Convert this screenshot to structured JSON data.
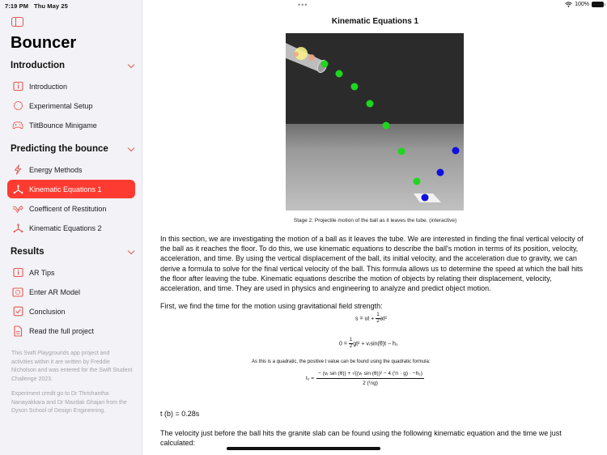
{
  "status_bar": {
    "time": "7:19 PM",
    "date": "Thu May 25",
    "battery": "100%",
    "multitask_dots": "•••"
  },
  "sidebar": {
    "app_title": "Bouncer",
    "sections": [
      {
        "title": "Introduction",
        "items": [
          {
            "label": "Introduction",
            "icon": "info-icon"
          },
          {
            "label": "Experimental Setup",
            "icon": "dashed-circle-icon"
          },
          {
            "label": "TiltBounce Minigame",
            "icon": "gamecontroller-icon"
          }
        ]
      },
      {
        "title": "Predicting the bounce",
        "items": [
          {
            "label": "Energy Methods",
            "icon": "bolt-icon"
          },
          {
            "label": "Kinematic Equations 1",
            "icon": "axes-icon",
            "active": true
          },
          {
            "label": "Coefficent of Restitution",
            "icon": "arrow-bounce-icon"
          },
          {
            "label": "Kinematic Equations 2",
            "icon": "axes-icon"
          }
        ]
      },
      {
        "title": "Results",
        "items": [
          {
            "label": "AR Tips",
            "icon": "info-icon"
          },
          {
            "label": "Enter AR Model",
            "icon": "ar-viewfinder-icon"
          },
          {
            "label": "Conclusion",
            "icon": "checkmark-square-icon"
          },
          {
            "label": "Read the full project",
            "icon": "document-icon"
          }
        ]
      }
    ],
    "footer": [
      "This Swift Playgrounds app project and activities within it are written by Freddie Nicholson and was entered for the Swift Student Challenge 2023.",
      "Experiment credit go to Dr Thrishantha Nanayakkara and Dr Mazdak Ghajari from the Dyson School of Design Engineering."
    ],
    "accent_color": "#fe3b30"
  },
  "main": {
    "title": "Kinematic Equations 1",
    "scene_caption": "Stage 2: Projectile motion of the ball as it leaves the tube. (interactive)",
    "intro_paragraph": "In this section, we are investigating the motion of a ball as it leaves the tube. We are interested in finding the final vertical velocity of the ball as it reaches the floor. To do this, we use kinematic equations to describe the ball's motion in terms of its position, velocity, acceleration, and time. By using the vertical displacement of the ball, its initial velocity, and the acceleration due to gravity, we can derive a formula to solve for the final vertical velocity of the ball. This formula allows us to determine the speed at which the ball hits the floor after leaving the tube. Kinematic equations describe the motion of objects by relating their displacement, velocity, acceleration, and time. They are used in physics and engineering to analyze and predict object motion.",
    "time_intro": "First, we find the time for the motion using gravitational field strength:",
    "eq1_left": "s = ut +",
    "eq1_right": "at²",
    "eq2_left": "0 =",
    "eq2_right": "gt² + vᵣsin(θ)t − h₀",
    "half_num": "1",
    "half_den": "2",
    "quadratic_note": "As this is a quadratic, the positive t value can be found using the quadratic formula:",
    "quadratic_lhs": "t₀ =",
    "quadratic_numerator": "− (vᵣ sin (θ)) + √((vᵣ sin (θ))² − 4 (½ · g) · −h₂)",
    "quadratic_denominator": "2 (½g)",
    "time_result": "t (b) = 0.28s",
    "velocity_intro": "The velocity just before the ball hits the granite slab can be found using the following kinematic equation and the time we just calculated:"
  }
}
